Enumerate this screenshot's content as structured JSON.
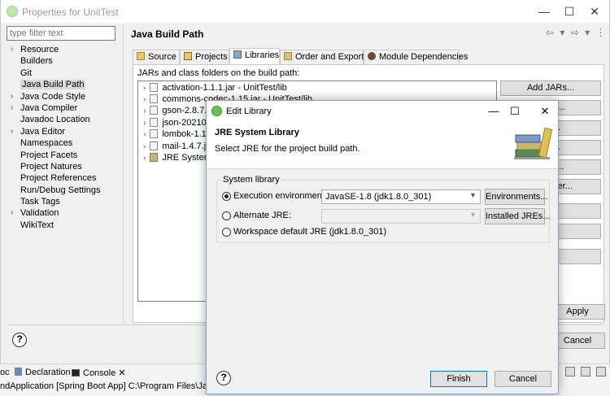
{
  "window": {
    "title": "Properties for UnitTest",
    "controls": [
      "—",
      "☐",
      "✕"
    ]
  },
  "filter": {
    "placeholder": "type filter text"
  },
  "tree": [
    {
      "label": "Resource",
      "expandable": true
    },
    {
      "label": "Builders",
      "expandable": false
    },
    {
      "label": "Git",
      "expandable": false
    },
    {
      "label": "Java Build Path",
      "expandable": false,
      "selected": true
    },
    {
      "label": "Java Code Style",
      "expandable": true
    },
    {
      "label": "Java Compiler",
      "expandable": true
    },
    {
      "label": "Javadoc Location",
      "expandable": false
    },
    {
      "label": "Java Editor",
      "expandable": true
    },
    {
      "label": "Namespaces",
      "expandable": false
    },
    {
      "label": "Project Facets",
      "expandable": false
    },
    {
      "label": "Project Natures",
      "expandable": false
    },
    {
      "label": "Project References",
      "expandable": false
    },
    {
      "label": "Run/Debug Settings",
      "expandable": false
    },
    {
      "label": "Task Tags",
      "expandable": false
    },
    {
      "label": "Validation",
      "expandable": true
    },
    {
      "label": "WikiText",
      "expandable": false
    }
  ],
  "pane": {
    "title": "Java Build Path",
    "nav": "⇦ ▾ ⇨ ▾ ⋮",
    "tabs": [
      "Source",
      "Projects",
      "Libraries",
      "Order and Export",
      "Module Dependencies"
    ],
    "active_tab": "Libraries",
    "jars_label": "JARs and class folders on the build path:",
    "libraries": [
      "activation-1.1.1.jar - UnitTest/lib",
      "commons-codec-1.15.jar - UnitTest/lib",
      "gson-2.8.7.j",
      "json-202103",
      "lombok-1.18",
      "mail-1.4.7.ja",
      "JRE System"
    ],
    "side_buttons": [
      {
        "label": "Add JARs...",
        "disabled": false
      },
      {
        "label": "JARs...",
        "disabled": false
      },
      {
        "label": "ble...",
        "disabled": false
      },
      {
        "label": "ary...",
        "disabled": false
      },
      {
        "label": "older...",
        "disabled": false
      },
      {
        "label": "ss Folder...",
        "disabled": false
      },
      {
        "label": "",
        "disabled": false
      },
      {
        "label": "e",
        "disabled": false
      },
      {
        "label": "File...",
        "disabled": true
      }
    ],
    "apply_label": "Apply",
    "cancel_label": "Cancel",
    "help_glyph": "?"
  },
  "console": {
    "tabs": [
      "oc",
      "Declaration",
      "Console ✕"
    ],
    "line": "ndApplication [Spring Boot App] C:\\Program Files\\Java\\jd"
  },
  "dialog": {
    "title": "Edit Library",
    "controls": [
      "—",
      "☐",
      "✕"
    ],
    "header_title": "JRE System Library",
    "header_desc": "Select JRE for the project build path.",
    "group_label": "System library",
    "options": [
      {
        "label": "Execution environment:",
        "selected": true,
        "combo": "JavaSE-1.8 (jdk1.8.0_301)",
        "button": "Environments..."
      },
      {
        "label": "Alternate JRE:",
        "selected": false,
        "combo": "",
        "button": "Installed JREs..."
      },
      {
        "label": "Workspace default JRE (jdk1.8.0_301)",
        "selected": false
      }
    ],
    "finish_label": "Finish",
    "cancel_label": "Cancel",
    "help_glyph": "?"
  }
}
